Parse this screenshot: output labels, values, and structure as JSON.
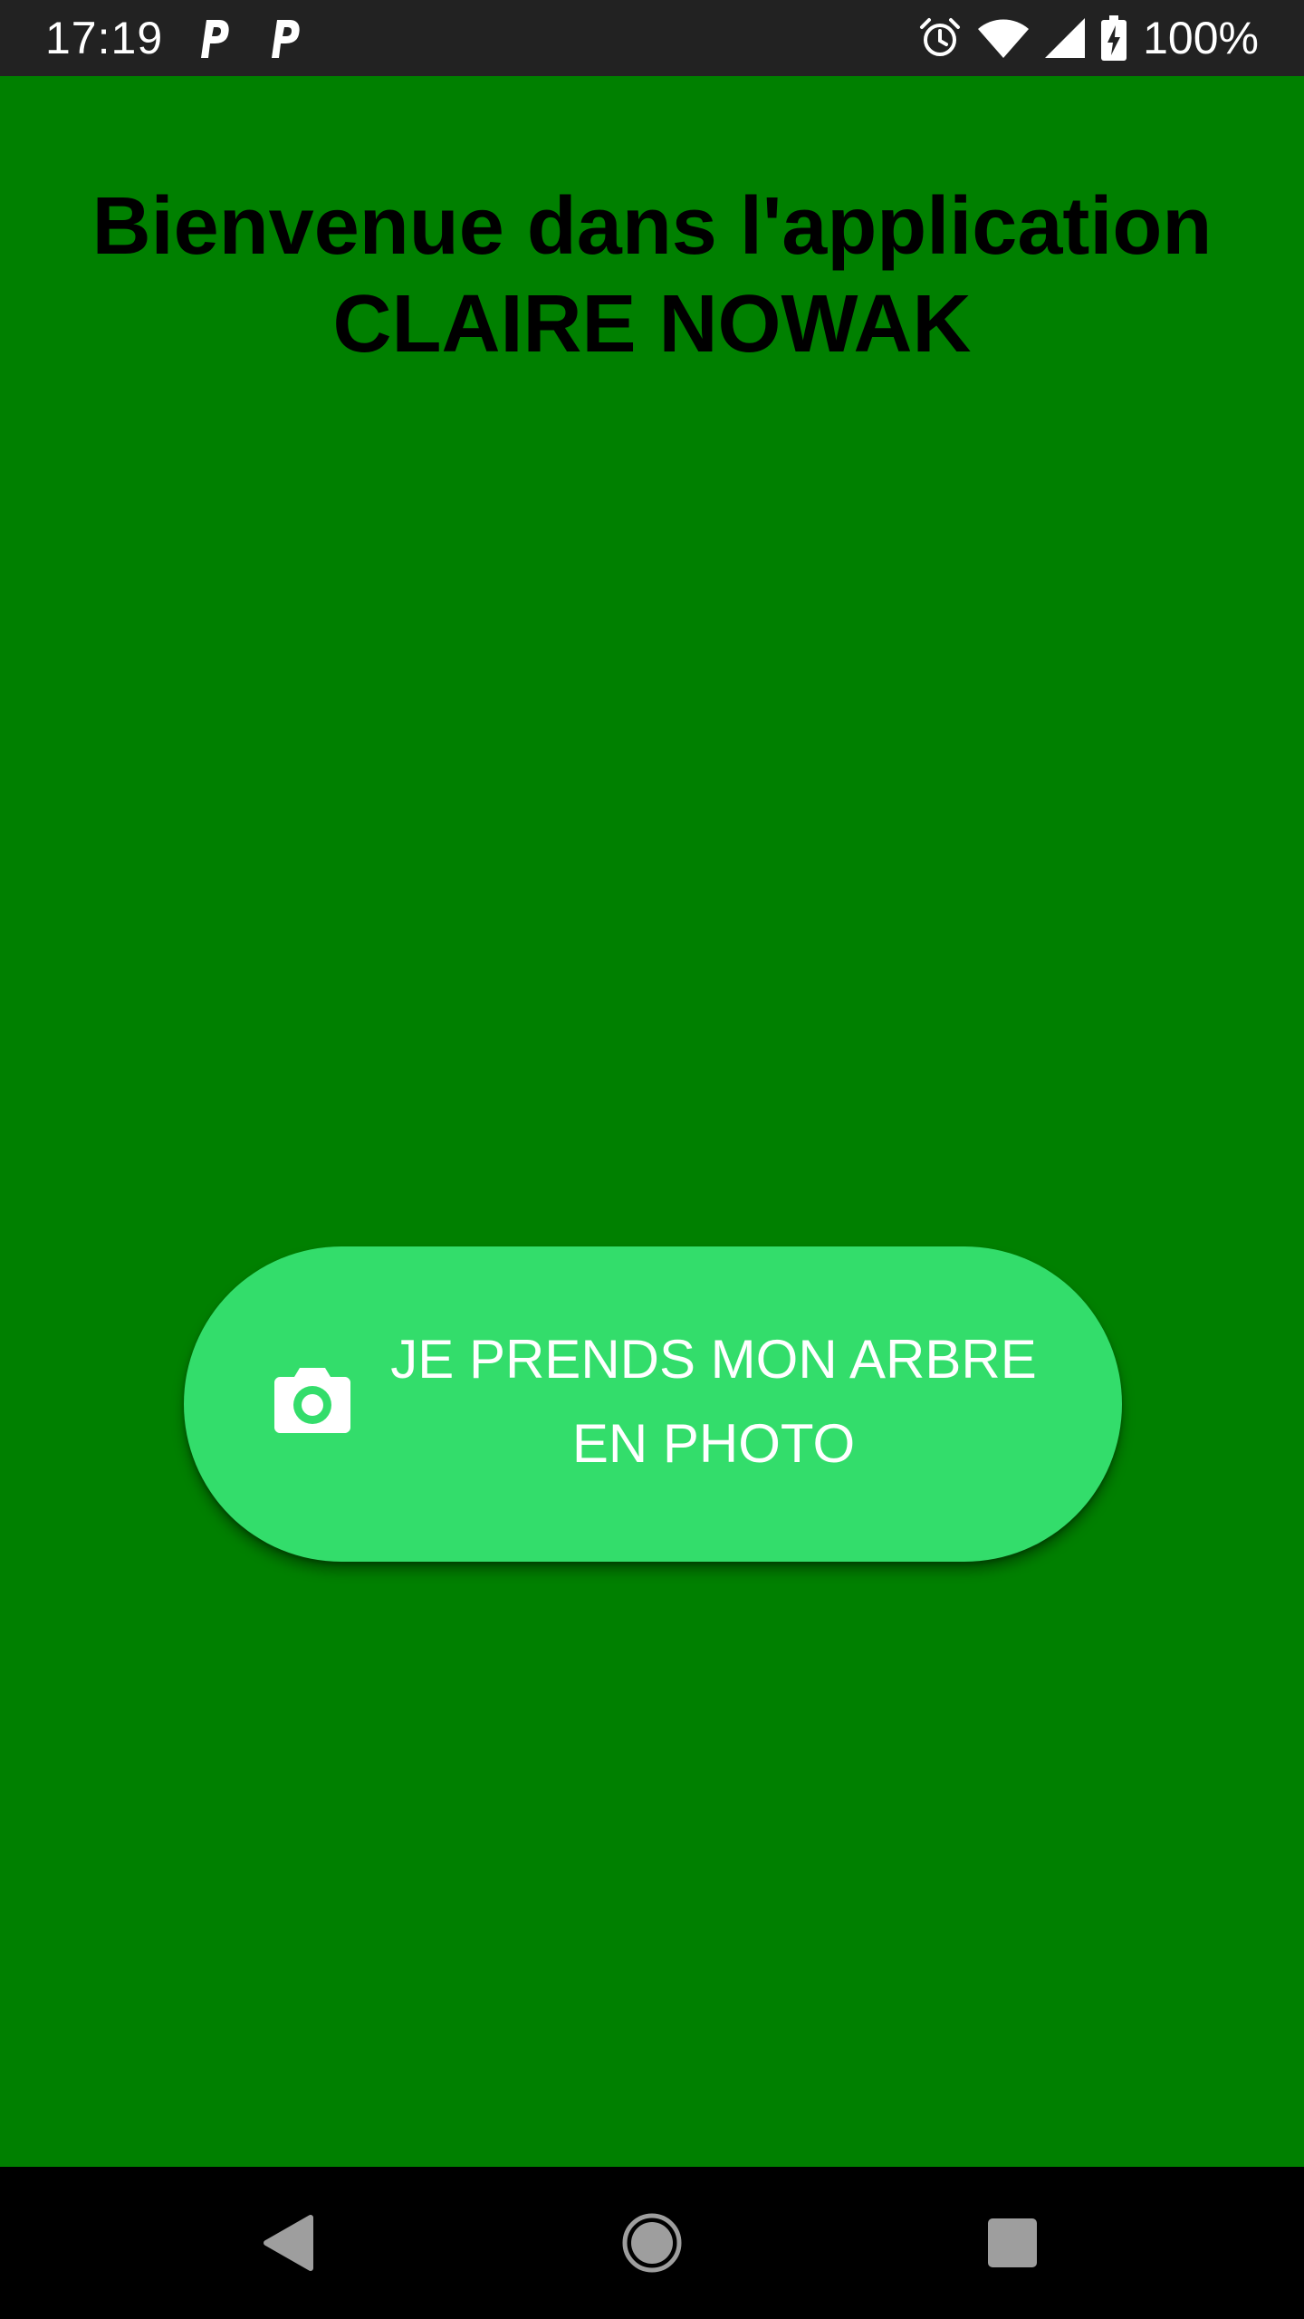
{
  "status_bar": {
    "time": "17:19",
    "notification_icons": [
      "parking-p-icon",
      "parking-p-icon"
    ],
    "system_icons": [
      "alarm-icon",
      "wifi-icon",
      "signal-icon",
      "battery-charging-icon"
    ],
    "battery_percent": "100%"
  },
  "welcome": {
    "line1": "Bienvenue dans l'application",
    "line2": "CLAIRE NOWAK"
  },
  "photo_button": {
    "icon": "camera-icon",
    "line1": "JE PRENDS MON ARBRE",
    "line2": "EN PHOTO"
  },
  "nav_bar": {
    "buttons": [
      "back-icon",
      "home-icon",
      "recents-icon"
    ]
  },
  "colors": {
    "background": "#008000",
    "button": "#33dd6b",
    "status_bar": "#222222",
    "nav_bar": "#000000",
    "title_text": "#000000",
    "button_text": "#ffffff"
  }
}
